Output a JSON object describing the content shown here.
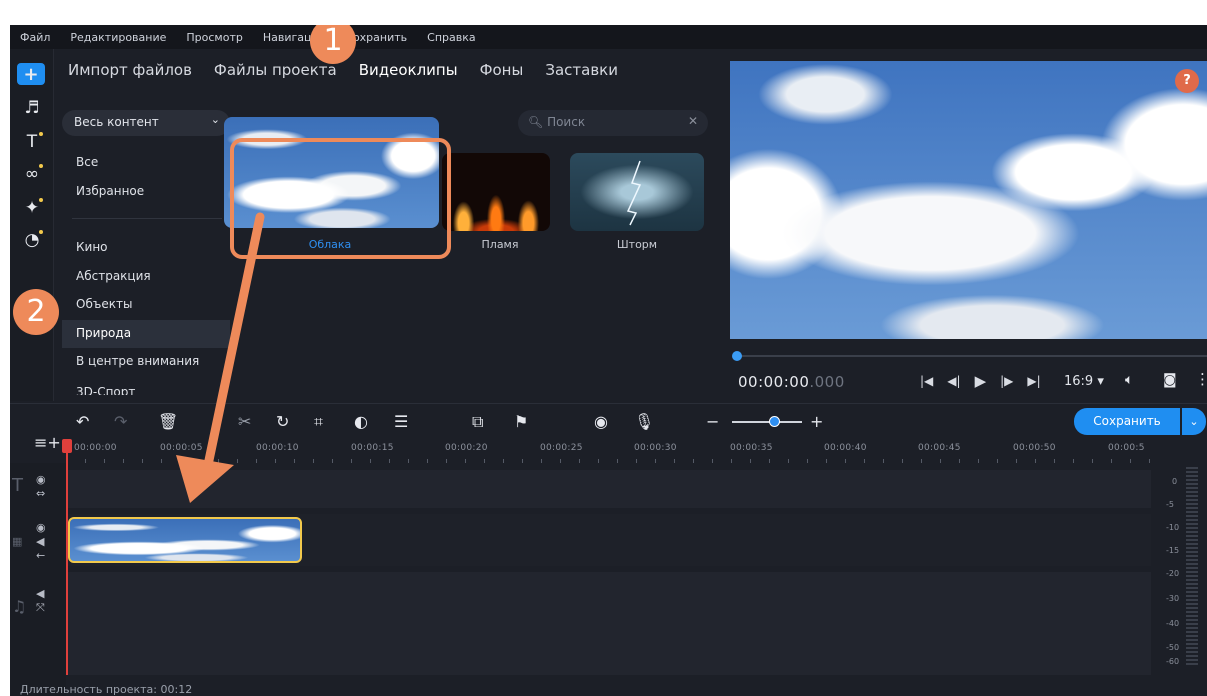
{
  "menu": [
    "Файл",
    "Редактирование",
    "Просмотр",
    "Навигация",
    "Сохранить",
    "Справка"
  ],
  "tabs": [
    "Импорт файлов",
    "Файлы проекта",
    "Видеоклипы",
    "Фоны",
    "Заставки"
  ],
  "sidebar": {
    "dropdown": "Весь контент",
    "items": [
      "Все",
      "Избранное",
      "Кино",
      "Абстракция",
      "Объекты",
      "Природа",
      "В центре внимания",
      "3D-Спорт"
    ],
    "selected": "Природа"
  },
  "search": {
    "placeholder": "Поиск"
  },
  "clips": [
    {
      "label": "Облака"
    },
    {
      "label": "Пламя"
    },
    {
      "label": "Шторм"
    }
  ],
  "player": {
    "time_main": "00:00:00",
    "time_ms": ".000",
    "aspect": "16:9 ▾",
    "help": "?"
  },
  "timeline": {
    "save_label": "Сохранить",
    "ruler": [
      "00:00:00",
      "00:00:05",
      "00:00:10",
      "00:00:15",
      "00:00:20",
      "00:00:25",
      "00:00:30",
      "00:00:35",
      "00:00:40",
      "00:00:45",
      "00:00:50",
      "00:00:5"
    ],
    "vu_labels": [
      "0",
      "-5",
      "-10",
      "-15",
      "-20",
      "-30",
      "-40",
      "-50",
      "-60"
    ]
  },
  "status": "Длительность проекта: 00:12",
  "annotations": [
    "1",
    "2"
  ],
  "colors": {
    "accent": "#1f8ef1",
    "annotation": "#ee8a5a",
    "clip_border": "#f2c94c",
    "playhead": "#e0403c"
  }
}
